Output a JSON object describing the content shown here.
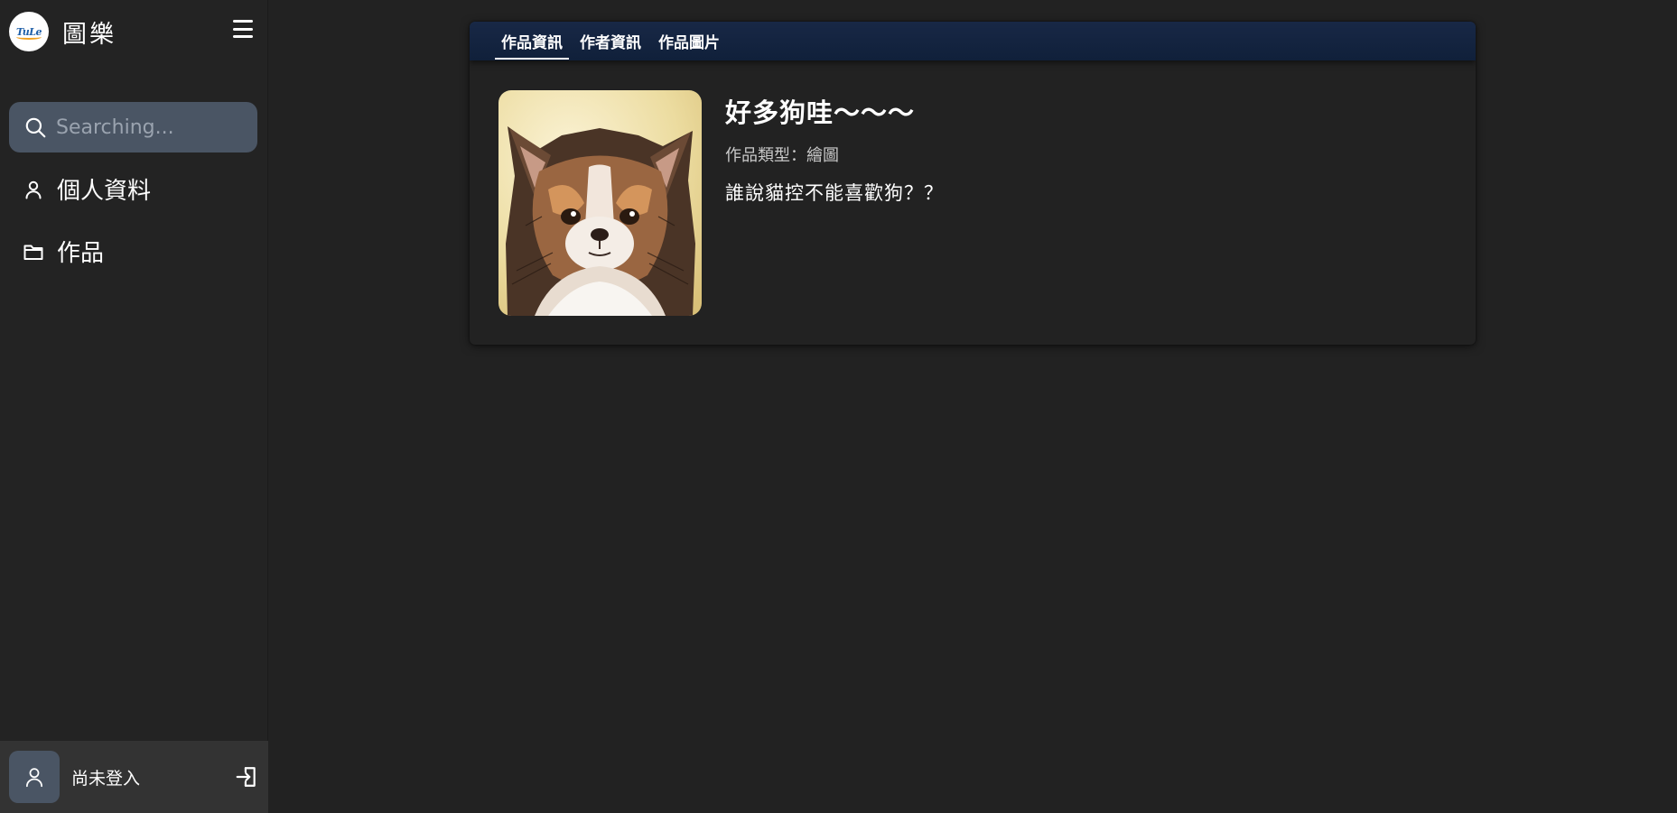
{
  "app": {
    "logo_text": "TuLe",
    "name": "圖樂"
  },
  "sidebar": {
    "search": {
      "placeholder": "Searching...",
      "value": ""
    },
    "items": [
      {
        "label": "個人資料",
        "icon": "user-icon"
      },
      {
        "label": "作品",
        "icon": "folder-icon"
      }
    ],
    "user": {
      "status": "尚未登入",
      "icon": "user-icon",
      "action_icon": "login-icon"
    }
  },
  "main": {
    "tabs": [
      {
        "label": "作品資訊",
        "active": true
      },
      {
        "label": "作者資訊",
        "active": false
      },
      {
        "label": "作品圖片",
        "active": false
      }
    ],
    "work": {
      "title": "好多狗哇～～～",
      "type_label": "作品類型：",
      "type_value": "繪圖",
      "description": "誰說貓控不能喜歡狗？？",
      "image_subject": "chihuahua-illustration"
    }
  },
  "colors": {
    "background": "#222222",
    "sidebar": "#232323",
    "search_bg": "#4a5564",
    "tab_bar": "#182846",
    "user_bar": "#333333"
  }
}
